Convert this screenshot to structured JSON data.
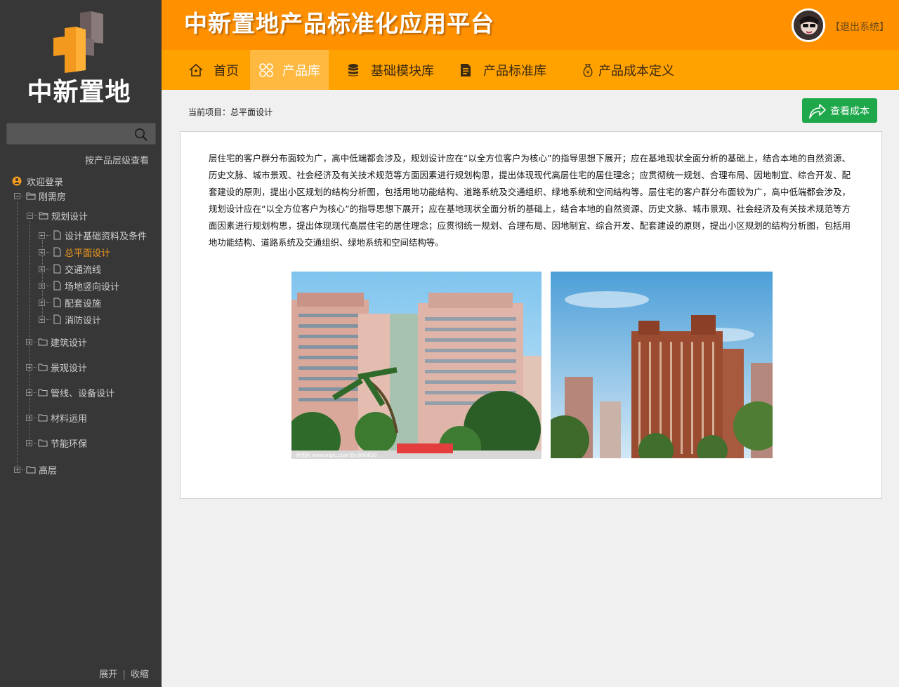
{
  "sidebar": {
    "logo_text": "中新置地",
    "search": {
      "placeholder": ""
    },
    "hierarchy_link": "按产品层级查看",
    "tree": {
      "welcome": "欢迎登录",
      "node_1": "刚需房",
      "node_1_1": "规划设计",
      "leaf_1": "设计基础资料及条件",
      "leaf_2": "总平面设计",
      "leaf_3": "交通流线",
      "leaf_4": "场地竖向设计",
      "leaf_5": "配套设施",
      "leaf_6": "消防设计",
      "node_1_2": "建筑设计",
      "node_1_3": "景观设计",
      "node_1_4": "管线、设备设计",
      "node_1_5": "材料运用",
      "node_1_6": "节能环保",
      "node_2": "高层"
    },
    "expand_label": "展开",
    "separator": "|",
    "collapse_label": "收缩"
  },
  "header": {
    "title": "中新置地产品标准化应用平台",
    "logout": "【退出系统】"
  },
  "nav": {
    "home": "首页",
    "product_library": "产品库",
    "module_library": "基础模块库",
    "standard_library": "产品标准库",
    "cost_definition": "产品成本定义"
  },
  "main": {
    "breadcrumb": "当前项目：总平面设计",
    "view_cost_button": "查看成本",
    "description": "层住宅的客户群分布面较为广，高中低端都会涉及，规划设计应在“以全方位客户为核心”的指导思想下展开；应在基地现状全面分析的基础上，结合本地的自然资源、历史文脉、城市景观、社会经济及有关技术规范等方面因素进行规划构思，提出体现现代高层住宅的居住理念；应贯彻统一规划、合理布局、因地制宜、综合开发、配套建设的原则，提出小区规划的结构分析图，包括用地功能结构、道路系统及交通组织、绿地系统和空间结构等。层住宅的客户群分布面较为广，高中低端都会涉及，规划设计应在“以全方位客户为核心”的指导思想下展开；应在基地现状全面分析的基础上，结合本地的自然资源、历史文脉、城市景观、社会经济及有关技术规范等方面因素进行规划构思，提出体现现代高层住宅的居住理念；应贯彻统一规划、合理布局、因地制宜、综合开发、配套建设的原则，提出小区规划的结构分析图，包括用地功能结构、道路系统及交通组织、绿地系统和空间结构等。",
    "photo_1_watermark": "昵图网 www.nipic.com  By:800600"
  },
  "colors": {
    "sidebar_bg": "#373737",
    "header_bg": "#ff9100",
    "nav_bg": "#ffa200",
    "nav_active_bg": "#ffb940",
    "tree_active": "#f39a1e",
    "cost_button": "#1fa84b"
  },
  "icons": {
    "search": "search-icon",
    "home": "home-icon",
    "product": "grid-icon",
    "module": "database-icon",
    "standard": "document-icon",
    "cost": "money-bag-icon",
    "share": "share-arrow-icon",
    "folder": "folder-icon",
    "file": "file-icon",
    "user": "user-status-icon"
  }
}
